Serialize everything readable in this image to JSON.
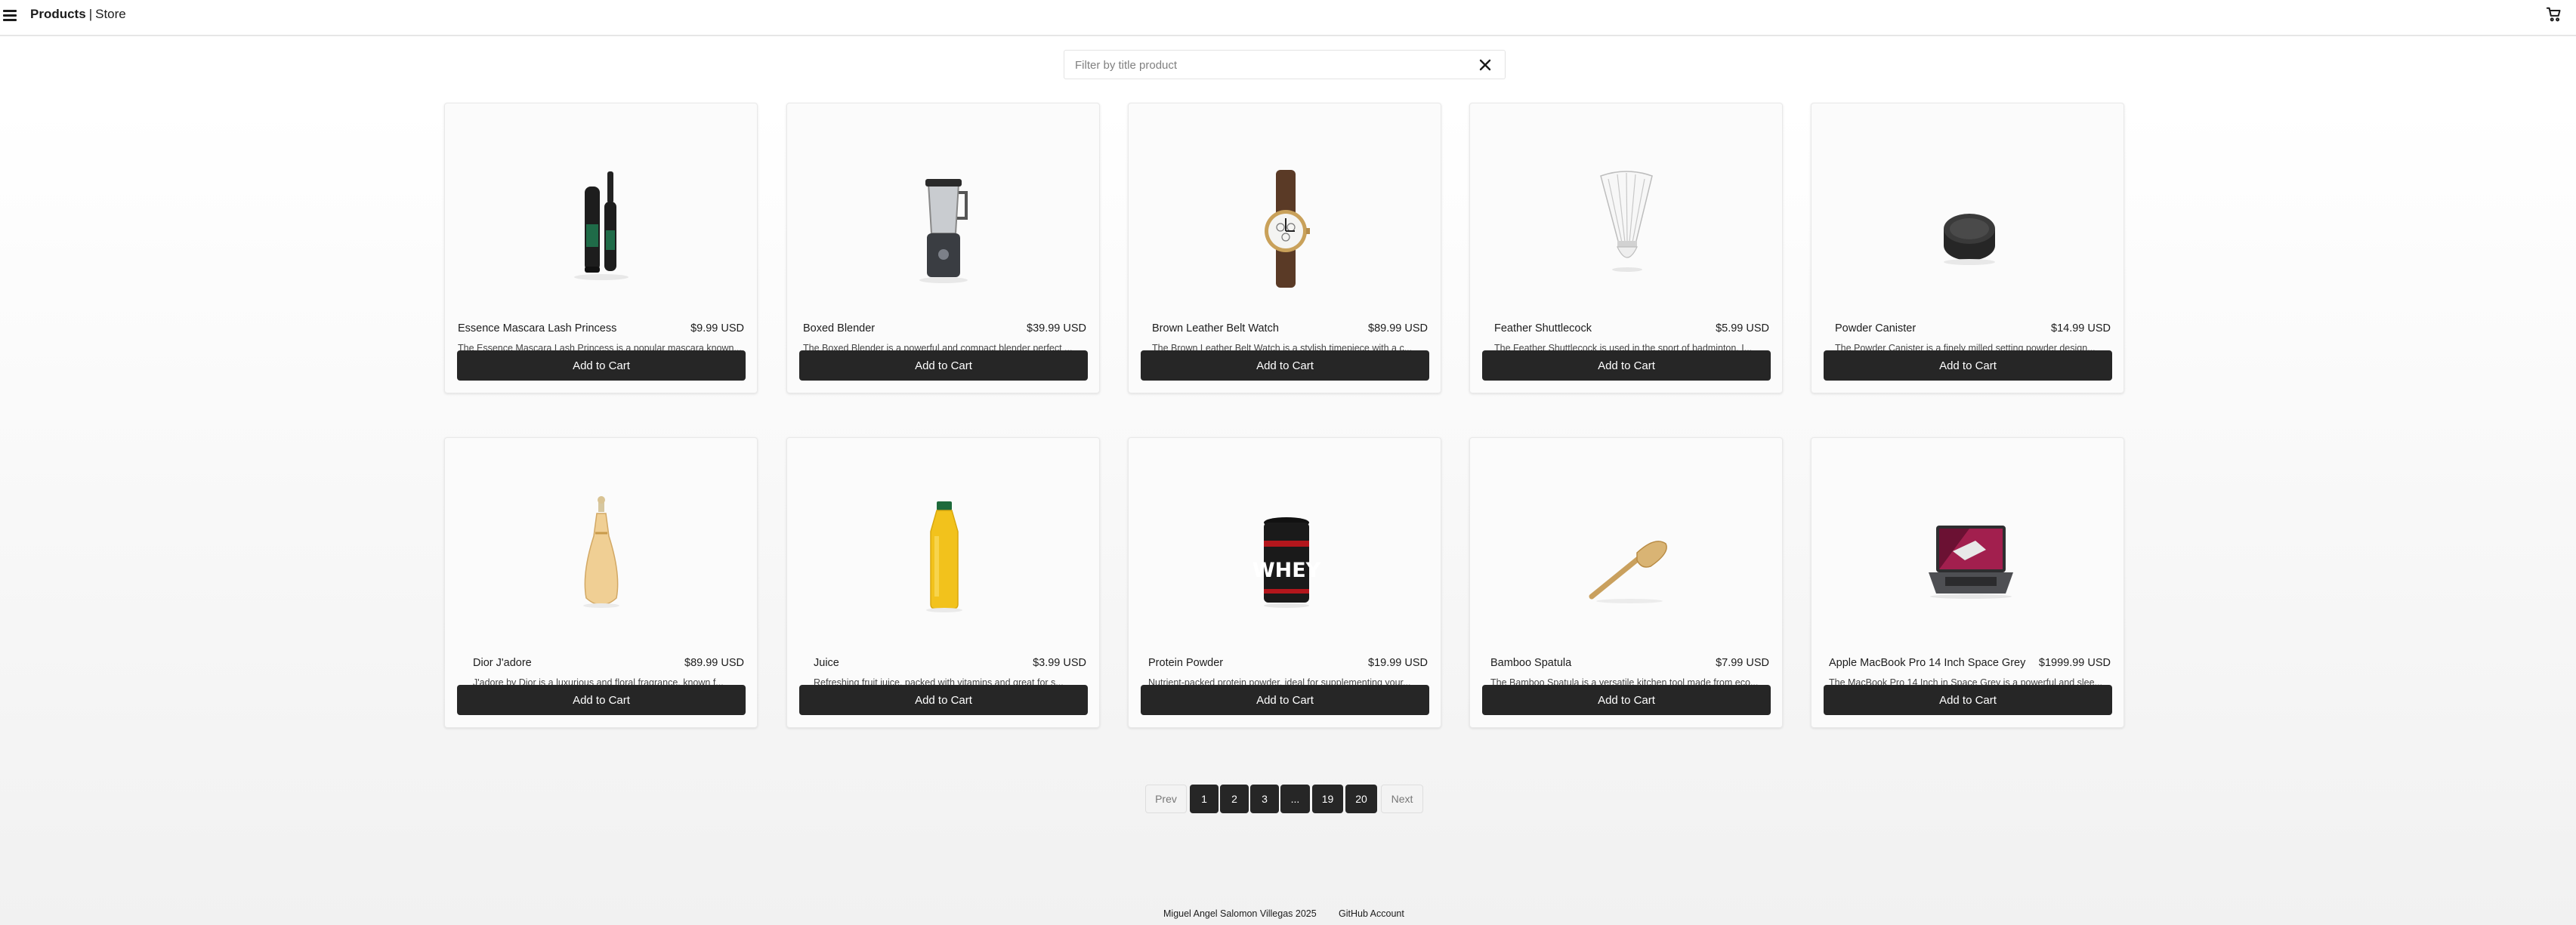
{
  "header": {
    "brand_bold": "Products",
    "brand_separator": "|",
    "brand_rest": "Store",
    "menu_icon": "hamburger-menu-icon",
    "cart_icon": "shopping-cart-icon"
  },
  "search": {
    "placeholder": "Filter by title product",
    "value": "",
    "clear_icon": "close-icon"
  },
  "products": [
    {
      "title": "Essence Mascara Lash Princess",
      "price": "$9.99 USD",
      "description": "The Essence Mascara Lash Princess is a popular mascara known...",
      "image": "mascara"
    },
    {
      "title": "Boxed Blender",
      "price": "$39.99 USD",
      "description": "The Boxed Blender is a powerful and compact blender perfect ...",
      "image": "blender"
    },
    {
      "title": "Brown Leather Belt Watch",
      "price": "$89.99 USD",
      "description": "The Brown Leather Belt Watch is a stylish timepiece with a c...",
      "image": "watch"
    },
    {
      "title": "Feather Shuttlecock",
      "price": "$5.99 USD",
      "description": "The Feather Shuttlecock is used in the sport of badminton. I...",
      "image": "shuttlecock"
    },
    {
      "title": "Powder Canister",
      "price": "$14.99 USD",
      "description": "The Powder Canister is a finely milled setting powder design...",
      "image": "powder"
    },
    {
      "title": "Dior J'adore",
      "price": "$89.99 USD",
      "description": "J'adore by Dior is a luxurious and floral fragrance, known f...",
      "image": "perfume"
    },
    {
      "title": "Juice",
      "price": "$3.99 USD",
      "description": "Refreshing fruit juice, packed with vitamins and great for s...",
      "image": "juice"
    },
    {
      "title": "Protein Powder",
      "price": "$19.99 USD",
      "description": "Nutrient-packed protein powder, ideal for supplementing your...",
      "image": "protein"
    },
    {
      "title": "Bamboo Spatula",
      "price": "$7.99 USD",
      "description": "The Bamboo Spatula is a versatile kitchen tool made from eco...",
      "image": "spatula"
    },
    {
      "title": "Apple MacBook Pro 14 Inch Space Grey",
      "price": "$1999.99 USD",
      "description": "The MacBook Pro 14 Inch in Space Grey is a powerful and slee...",
      "image": "laptop"
    }
  ],
  "add_to_cart_label": "Add to Cart",
  "protein_label": "WHEY",
  "pagination": {
    "prev": "Prev",
    "next": "Next",
    "pages": [
      "1",
      "2",
      "3",
      "...",
      "19",
      "20"
    ]
  },
  "footer": {
    "author": "Miguel Angel Salomon Villegas 2025",
    "github": "GitHub Account"
  }
}
